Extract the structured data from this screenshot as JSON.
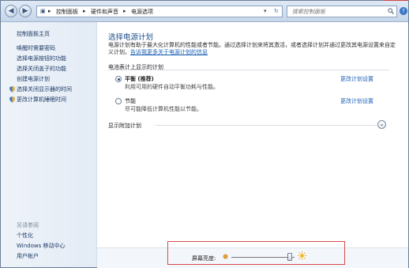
{
  "address_bar": {
    "segments": [
      "控制面板",
      "硬件和声音",
      "电源选项"
    ],
    "separator": "▸"
  },
  "search": {
    "placeholder": "搜索控制面板"
  },
  "help": {
    "label": "?"
  },
  "sidebar": {
    "home": "控制面板主页",
    "items": [
      {
        "label": "唤醒时需要密码",
        "shield": false
      },
      {
        "label": "选择电源按钮的功能",
        "shield": false
      },
      {
        "label": "选择关闭盖子的功能",
        "shield": false
      },
      {
        "label": "创建电源计划",
        "shield": false
      },
      {
        "label": "选择关闭显示器的时间",
        "shield": true
      },
      {
        "label": "更改计算机睡眠时间",
        "shield": true
      }
    ],
    "see_also_title": "另请参阅",
    "see_also": [
      "个性化",
      "Windows 移动中心",
      "用户帐户"
    ]
  },
  "main": {
    "heading": "选择电源计划",
    "description": "电源计划有助于最大化计算机的性能或者节能。通过选择计划来将其激活，或者选择计划并通过更改其电源设置来自定义计划。",
    "learn_more_link": "告诉我更多关于电源计划的信息",
    "group_label": "电池表计上显示的计划",
    "plans": [
      {
        "name": "平衡 (推荐)",
        "description": "利用可用的硬件自动平衡功耗与性能。",
        "change_link": "更改计划设置",
        "selected": true
      },
      {
        "name": "节能",
        "description": "尽可能降低计算机性能以节能。",
        "change_link": "更改计划设置",
        "selected": false
      }
    ],
    "show_more": "显示附加计划",
    "expand_glyph": "⌄"
  },
  "brightness": {
    "label": "屏幕亮度:",
    "level": 0.92
  },
  "colors": {
    "link": "#1a5fb4",
    "heading": "#1e4e8c",
    "highlight": "#d94a4a"
  }
}
